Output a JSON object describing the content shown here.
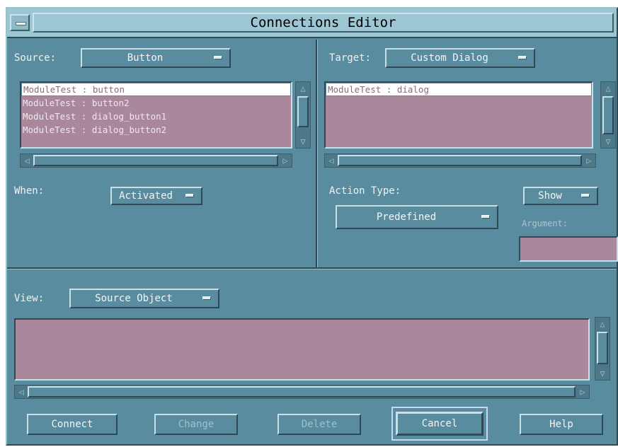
{
  "window": {
    "title": "Connections Editor"
  },
  "source": {
    "label": "Source:",
    "menu_value": "Button",
    "items": [
      "ModuleTest : button",
      "ModuleTest : button2",
      "ModuleTest : dialog_button1",
      "ModuleTest : dialog_button2"
    ],
    "selected_index": 0
  },
  "target": {
    "label": "Target:",
    "menu_value": "Custom Dialog",
    "items": [
      "ModuleTest : dialog"
    ],
    "selected_index": 0
  },
  "when": {
    "label": "When:",
    "menu_value": "Activated"
  },
  "action": {
    "label": "Action Type:",
    "menu_value": "Predefined",
    "show_value": "Show",
    "argument_label": "Argument:",
    "argument_value": ""
  },
  "view": {
    "label": "View:",
    "menu_value": "Source Object"
  },
  "buttons": {
    "connect": "Connect",
    "change": "Change",
    "delete": "Delete",
    "cancel": "Cancel",
    "help": "Help"
  },
  "colors": {
    "window_bg": "#5a8ca0",
    "list_bg": "#a8889a",
    "titlebar_bg": "#9cc6d4"
  }
}
